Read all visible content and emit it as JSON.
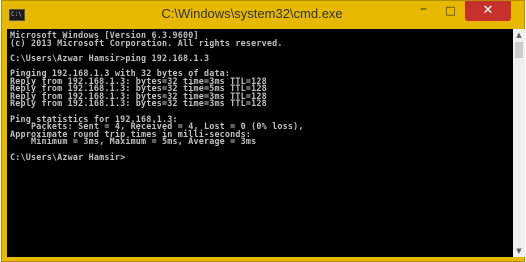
{
  "window": {
    "title": "C:\\Windows\\system32\\cmd.exe",
    "icon_label": "C:\\",
    "controls": {
      "minimize": "–",
      "maximize": "□",
      "close": "✕"
    }
  },
  "console": {
    "lines": [
      "Microsoft Windows [Version 6.3.9600]",
      "(c) 2013 Microsoft Corporation. All rights reserved.",
      "",
      "C:\\Users\\Azwar Hamsir>ping 192.168.1.3",
      "",
      "Pinging 192.168.1.3 with 32 bytes of data:",
      "Reply from 192.168.1.3: bytes=32 time=3ms TTL=128",
      "Reply from 192.168.1.3: bytes=32 time=5ms TTL=128",
      "Reply from 192.168.1.3: bytes=32 time=3ms TTL=128",
      "Reply from 192.168.1.3: bytes=32 time=3ms TTL=128",
      "",
      "Ping statistics for 192.168.1.3:",
      "    Packets: Sent = 4, Received = 4, Lost = 0 (0% loss),",
      "Approximate round trip times in milli-seconds:",
      "    Minimum = 3ms, Maximum = 5ms, Average = 3ms",
      "",
      "C:\\Users\\Azwar Hamsir>"
    ]
  },
  "scrollbar": {
    "up_arrow": "▲",
    "down_arrow": "▼"
  }
}
